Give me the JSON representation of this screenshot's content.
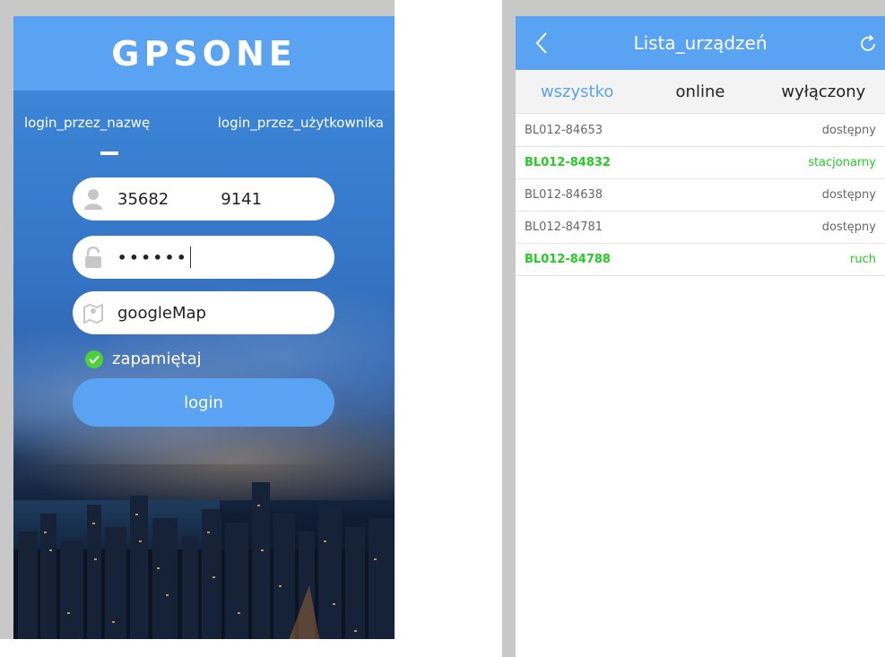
{
  "login_screen": {
    "brand": "GPSONE",
    "tabs": [
      "login_przez_nazwę",
      "login_przez_użytkownika"
    ],
    "user_id_part1": "35682",
    "user_id_part2": "9141",
    "password_masked": "••••••",
    "map_value": "googleMap",
    "remember_label": "zapamiętaj",
    "login_button": "login",
    "icons": {
      "user": "user-icon",
      "lock": "lock-icon",
      "map": "map-icon",
      "check": "check-circle-icon"
    }
  },
  "device_list": {
    "title": "Lista_urządzeń",
    "tabs": [
      "wszystko",
      "online",
      "wyłączony"
    ],
    "active_tab": "wszystko",
    "rows": [
      {
        "name": "BL012-84653",
        "status": "dostępny"
      },
      {
        "name": "BL012-84832",
        "status": "stacjonarny"
      },
      {
        "name": "BL012-84638",
        "status": "dostępny"
      },
      {
        "name": "BL012-84781",
        "status": "dostępny"
      },
      {
        "name": "BL012-84788",
        "status": "ruch"
      }
    ],
    "icons": {
      "back": "back-arrow-icon",
      "refresh": "refresh-icon"
    }
  },
  "colors": {
    "accent": "#5aa2f2",
    "active_status": "#22cc22",
    "idle_status": "#666666"
  }
}
